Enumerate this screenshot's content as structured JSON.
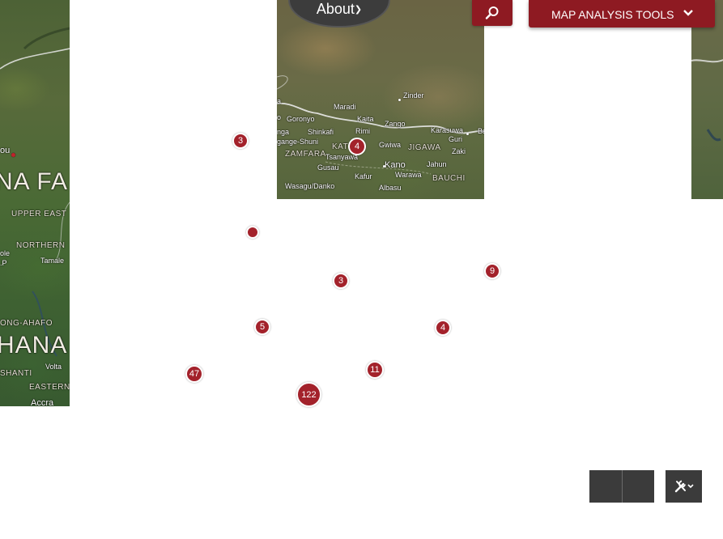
{
  "header": {
    "about_label": "About",
    "about_icon": "chevron-down-icon",
    "search_icon": "search-icon",
    "tools_label": "MAP ANALYSIS TOOLS",
    "tools_icon": "chevron-down-icon"
  },
  "colors": {
    "accent": "#8e1a22",
    "marker": "#a3222b",
    "control_bg": "#3b3b3b"
  },
  "map_labels_left": {
    "ou": "ou",
    "country1": "NA FA",
    "upper_east": "UPPER EAST",
    "northern": "NORTHERN",
    "tamale": "Tamale",
    "p": ".P",
    "ole": "ole",
    "ng_ahafo": "ONG-AHAFO",
    "country2": "HANA",
    "volta": "Volta",
    "shanti": "SHANTI",
    "eastern": "EASTERN",
    "accra": "Accra"
  },
  "map_labels_mid": {
    "zinder": "Zinder",
    "maradi": "Maradi",
    "goronyo": "Goronyo",
    "kaita": "Kaita",
    "zango": "Zango",
    "nga": "nga",
    "shinkafi": "Shinkafi",
    "rimi": "Rimi",
    "karasuwa": "Karasuwa",
    "guri": "Guri",
    "ba": "Ba",
    "gange_shuni": "gange-Shuni",
    "kats": "KATS",
    "gwiwa": "Gwiwa",
    "jigawa": "JIGAWA",
    "zaki": "Zaki",
    "zamfara": "ZAMFARA",
    "tsanyawa": "Tsanyawa",
    "gusau": "Gusau",
    "kano": "Kano",
    "jahun": "Jahun",
    "kafur": "Kafur",
    "warawa": "Warawa",
    "bauchi": "BAUCHI",
    "wasagu": "Wasagu/Danko",
    "albasu": "Albasu",
    "o": "o",
    "a": "a"
  },
  "markers": [
    "3",
    "",
    "3",
    "4",
    "9",
    "5",
    "4",
    "47",
    "11",
    "122"
  ],
  "controls": {
    "nav_prev_icon": "previous-extent-icon",
    "nav_next_icon": "next-extent-icon",
    "tool_toggle_icon": "tools-icon"
  }
}
